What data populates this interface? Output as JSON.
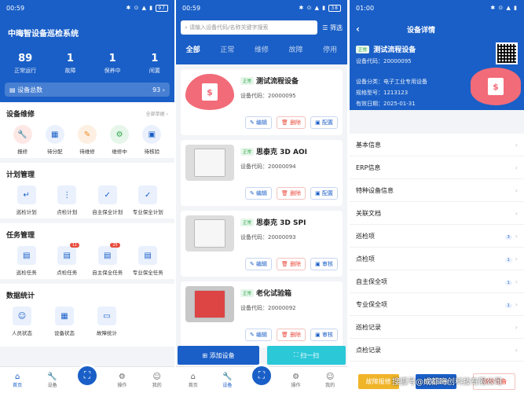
{
  "screen1": {
    "status": {
      "time": "00:59",
      "battery": "97"
    },
    "title": "中晦智设备巡检系统",
    "stats": [
      {
        "value": "89",
        "label": "正常运行"
      },
      {
        "value": "1",
        "label": "故障"
      },
      {
        "value": "1",
        "label": "保养中"
      },
      {
        "value": "1",
        "label": "闲置"
      }
    ],
    "total": {
      "label": "设备总数",
      "value": "93"
    },
    "sections": [
      {
        "title": "设备维修",
        "more": "全部单据",
        "items": [
          {
            "label": "报修",
            "icon": "wrench-icon"
          },
          {
            "label": "待分配",
            "icon": "assign-icon"
          },
          {
            "label": "待维修",
            "icon": "tool-icon"
          },
          {
            "label": "维修中",
            "icon": "repair-icon"
          },
          {
            "label": "待核验",
            "icon": "verify-icon"
          }
        ]
      },
      {
        "title": "计划管理",
        "items": [
          {
            "label": "巡检计划",
            "icon": "plan-icon"
          },
          {
            "label": "点检计划",
            "icon": "check-icon"
          },
          {
            "label": "自主保全计划",
            "icon": "maintain-icon"
          },
          {
            "label": "专业保全计划",
            "icon": "pro-icon"
          }
        ]
      },
      {
        "title": "任务管理",
        "items": [
          {
            "label": "巡检任务",
            "icon": "task-icon"
          },
          {
            "label": "点检任务",
            "icon": "task-icon",
            "badge": "11"
          },
          {
            "label": "自主保全任务",
            "icon": "task-icon",
            "badge": "25"
          },
          {
            "label": "专业保全任务",
            "icon": "task-icon"
          }
        ]
      },
      {
        "title": "数据统计",
        "items": [
          {
            "label": "人员状态",
            "icon": "people-icon"
          },
          {
            "label": "设备状态",
            "icon": "device-icon"
          },
          {
            "label": "故障统计",
            "icon": "fault-icon"
          }
        ]
      }
    ],
    "tabs": [
      "首页",
      "设备",
      "操作",
      "我的"
    ]
  },
  "screen2": {
    "status": {
      "time": "00:59",
      "battery": "38"
    },
    "search_placeholder": "请输入设备代码/名称关键字搜索",
    "filter": "筛选",
    "tabs": [
      "全部",
      "正常",
      "维修",
      "故障",
      "停用"
    ],
    "cards": [
      {
        "tag": "正常",
        "name": "测试流程设备",
        "code": "设备代码：20000095",
        "btn1": "编辑",
        "btn2": "删除",
        "btn3": "配置"
      },
      {
        "tag": "正常",
        "name": "思泰克 3D AOI",
        "code": "设备代码：20000094",
        "btn1": "编辑",
        "btn2": "删除",
        "btn3": "配置"
      },
      {
        "tag": "正常",
        "name": "思泰克 3D SPI",
        "code": "设备代码：20000093",
        "btn1": "编辑",
        "btn2": "删除",
        "btn3": "审核"
      },
      {
        "tag": "正常",
        "name": "老化试验箱",
        "code": "设备代码：20000092",
        "btn1": "编辑",
        "btn2": "删除",
        "btn3": "审核"
      }
    ],
    "add": "添加设备",
    "scan": "扫一扫",
    "tabbar": [
      "首页",
      "设备",
      "操作",
      "我的"
    ]
  },
  "screen3": {
    "status": {
      "time": "01:00"
    },
    "title": "设备详情",
    "tag": "正常",
    "name": "测试流程设备",
    "code": "设备代码：20000095",
    "category": "设备分类：电子工业专用设备",
    "model": "规格型号：1213123",
    "valid": "有效日期：2025-01-31",
    "menu": [
      {
        "label": "基本信息"
      },
      {
        "label": "ERP信息"
      },
      {
        "label": "特种设备信息"
      },
      {
        "label": "关联文档"
      },
      {
        "label": "巡检项",
        "count": "3"
      },
      {
        "label": "点检项",
        "count": "1"
      },
      {
        "label": "自主保全项",
        "count": "1"
      },
      {
        "label": "专业保全项",
        "count": "1"
      },
      {
        "label": "巡检记录"
      },
      {
        "label": "点检记录"
      }
    ],
    "btn1": "故障报修",
    "btn2": "编辑设备",
    "btn3": "删除设备"
  },
  "watermark": "搜狐号@成都晦创科技有限公司"
}
